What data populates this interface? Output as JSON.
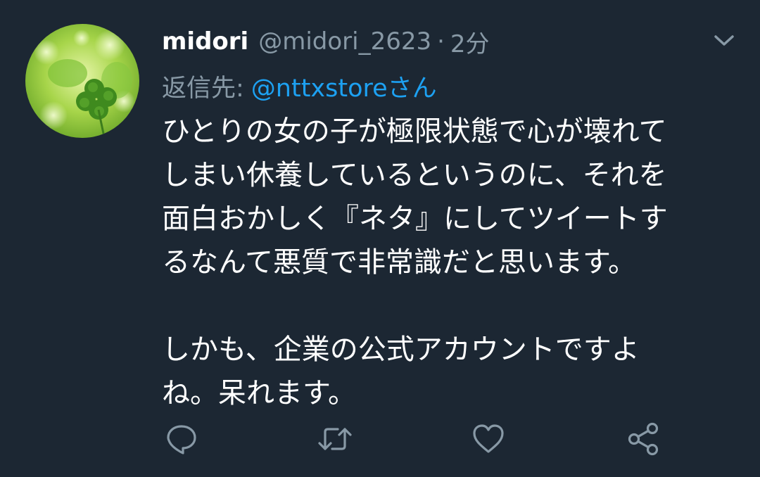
{
  "tweet": {
    "display_name": "midori",
    "handle": "@midori_2623",
    "separator": "·",
    "time": "2分",
    "reply_prefix": "返信先:",
    "reply_mention": "@nttxstoreさん",
    "body_lines": [
      "ひとりの女の子が極限状態で心が壊れて",
      "しまい休養しているというのに、それを",
      "面白おかしく『ネタ』にしてツイートす",
      "るなんて悪質で非常識だと思います。",
      "",
      "しかも、企業の公式アカウントですよ",
      "ね。呆れます。"
    ]
  },
  "icons": {
    "menu": "chevron-down-icon",
    "reply": "reply-icon",
    "retweet": "retweet-icon",
    "like": "heart-icon",
    "share": "share-icon"
  },
  "colors": {
    "background": "#1c2733",
    "primary_text": "#ffffff",
    "secondary_text": "#8899a6",
    "link": "#1da1f2",
    "avatar_green": "#8cc63f"
  }
}
